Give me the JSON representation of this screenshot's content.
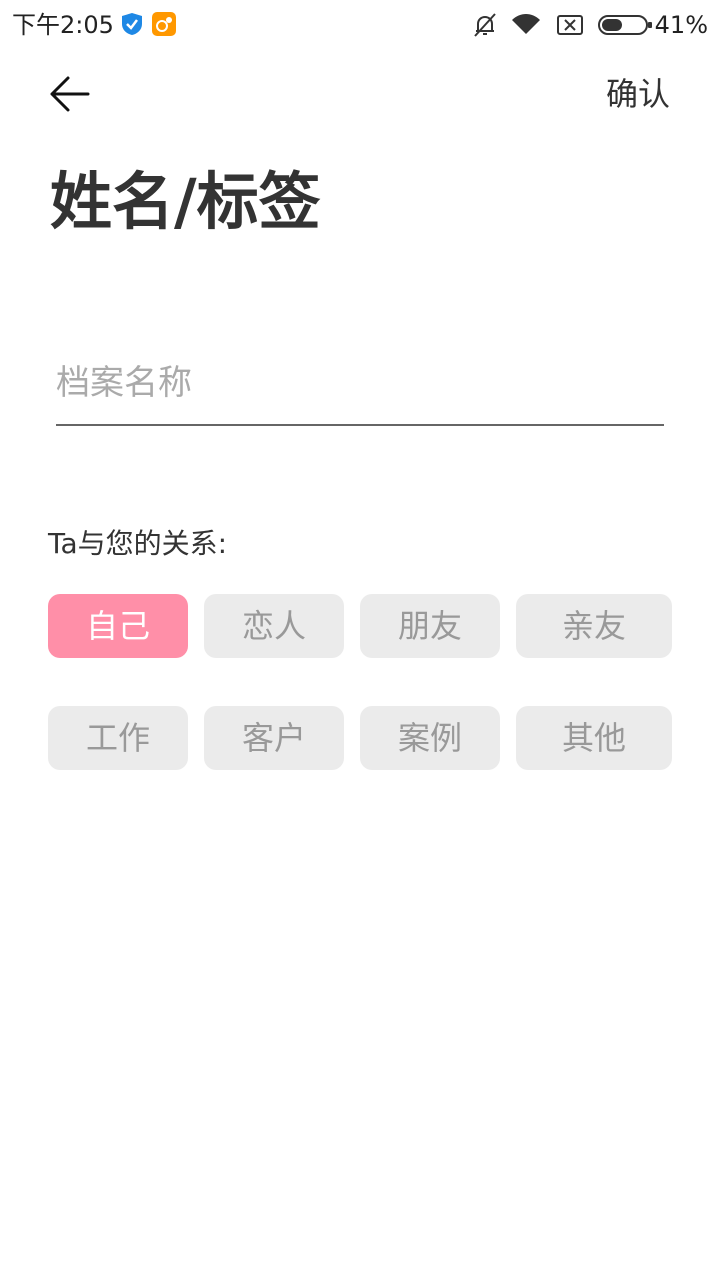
{
  "status_bar": {
    "time": "下午2:05",
    "battery": "41%"
  },
  "header": {
    "confirm_label": "确认"
  },
  "title": "姓名/标签",
  "name_field": {
    "placeholder": "档案名称",
    "value": ""
  },
  "relation": {
    "label": "Ta与您的关系:",
    "tags": [
      {
        "label": "自己",
        "selected": true
      },
      {
        "label": "恋人",
        "selected": false
      },
      {
        "label": "朋友",
        "selected": false
      },
      {
        "label": "亲友",
        "selected": false
      },
      {
        "label": "工作",
        "selected": false
      },
      {
        "label": "客户",
        "selected": false
      },
      {
        "label": "案例",
        "selected": false
      },
      {
        "label": "其他",
        "selected": false
      }
    ]
  },
  "colors": {
    "accent": "#ff8fa8",
    "chip_bg": "#ebebeb",
    "chip_text": "#999999"
  },
  "icons": {
    "back": "arrow-left-icon",
    "status": [
      "shield-icon",
      "uc-browser-icon",
      "bell-off-icon",
      "wifi-icon",
      "no-sim-icon",
      "battery-icon"
    ]
  }
}
